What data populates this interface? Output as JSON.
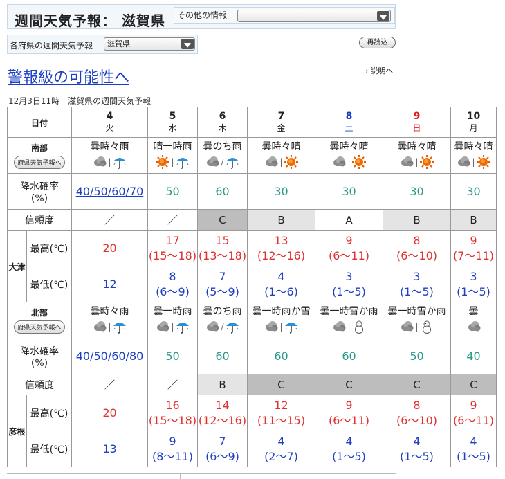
{
  "header": {
    "title": "週間天気予報： 滋賀県",
    "other_info_label": "その他の情報",
    "other_info_value": ""
  },
  "subbar": {
    "label": "各府県の週間天気予報",
    "pref_select_value": "滋賀県",
    "reload_label": "再読込"
  },
  "warning_link": "警報級の可能性へ",
  "explanation_link": "説明へ",
  "timestamp": "12月3日11時　滋賀県の週間天気予報",
  "table": {
    "date_header": "日付",
    "days": [
      {
        "num": "4",
        "wk": "火",
        "type": "weekday"
      },
      {
        "num": "5",
        "wk": "水",
        "type": "weekday"
      },
      {
        "num": "6",
        "wk": "木",
        "type": "weekday"
      },
      {
        "num": "7",
        "wk": "金",
        "type": "weekday"
      },
      {
        "num": "8",
        "wk": "土",
        "type": "sat"
      },
      {
        "num": "9",
        "wk": "日",
        "type": "sun"
      },
      {
        "num": "10",
        "wk": "月",
        "type": "weekday"
      }
    ],
    "rain_prob_label_1": "降水確率",
    "rain_prob_label_2": "(%)",
    "reliability_label": "信頼度",
    "high_label": "最高(℃)",
    "low_label": "最低(℃)",
    "regions": [
      {
        "name": "南部",
        "pref_button": "府県天気予報へ",
        "city": "大津",
        "weather": [
          {
            "text": "曇時々雨",
            "icons": [
              "cloud",
              "umbrella"
            ],
            "sep": "|"
          },
          {
            "text": "晴一時雨",
            "icons": [
              "sun",
              "umbrella"
            ],
            "sep": "|"
          },
          {
            "text": "曇のち雨",
            "icons": [
              "cloud",
              "umbrella"
            ],
            "sep": "/"
          },
          {
            "text": "曇時々晴",
            "icons": [
              "cloud",
              "sun"
            ],
            "sep": "|"
          },
          {
            "text": "曇時々晴",
            "icons": [
              "cloud",
              "sun"
            ],
            "sep": "|"
          },
          {
            "text": "曇時々晴",
            "icons": [
              "cloud",
              "sun"
            ],
            "sep": "|"
          },
          {
            "text": "曇時々晴",
            "icons": [
              "cloud",
              "sun"
            ],
            "sep": "|"
          }
        ],
        "rain": [
          "40/50/60/70",
          "50",
          "60",
          "30",
          "30",
          "30",
          "30"
        ],
        "reliability": [
          "／",
          "／",
          "C",
          "B",
          "A",
          "B",
          "B"
        ],
        "high": [
          {
            "v": "20",
            "r": ""
          },
          {
            "v": "17",
            "r": "(15〜18)"
          },
          {
            "v": "15",
            "r": "(13〜18)"
          },
          {
            "v": "13",
            "r": "(12〜16)"
          },
          {
            "v": "9",
            "r": "(6〜11)"
          },
          {
            "v": "8",
            "r": "(6〜10)"
          },
          {
            "v": "9",
            "r": "(7〜11)"
          }
        ],
        "low": [
          {
            "v": "12",
            "r": ""
          },
          {
            "v": "8",
            "r": "(6〜9)"
          },
          {
            "v": "7",
            "r": "(5〜9)"
          },
          {
            "v": "4",
            "r": "(1〜6)"
          },
          {
            "v": "3",
            "r": "(1〜5)"
          },
          {
            "v": "3",
            "r": "(1〜5)"
          },
          {
            "v": "3",
            "r": "(1〜5)"
          }
        ]
      },
      {
        "name": "北部",
        "pref_button": "府県天気予報へ",
        "city": "彦根",
        "weather": [
          {
            "text": "曇時々雨",
            "icons": [
              "cloud",
              "umbrella"
            ],
            "sep": "|"
          },
          {
            "text": "曇一時雨",
            "icons": [
              "cloud",
              "umbrella"
            ],
            "sep": "|"
          },
          {
            "text": "曇のち雨",
            "icons": [
              "cloud",
              "umbrella"
            ],
            "sep": "/"
          },
          {
            "text": "曇一時雨か雪",
            "icons": [
              "cloud",
              "umbrella"
            ],
            "sep": "|"
          },
          {
            "text": "曇一時雪か雨",
            "icons": [
              "cloud",
              "snowman"
            ],
            "sep": "|"
          },
          {
            "text": "曇一時雪か雨",
            "icons": [
              "cloud",
              "snowman"
            ],
            "sep": "|"
          },
          {
            "text": "曇",
            "icons": [
              "cloud"
            ],
            "sep": ""
          }
        ],
        "rain": [
          "40/50/60/80",
          "50",
          "60",
          "60",
          "60",
          "50",
          "40"
        ],
        "reliability": [
          "／",
          "／",
          "B",
          "C",
          "C",
          "C",
          "C"
        ],
        "high": [
          {
            "v": "20",
            "r": ""
          },
          {
            "v": "16",
            "r": "(15〜18)"
          },
          {
            "v": "14",
            "r": "(12〜16)"
          },
          {
            "v": "12",
            "r": "(11〜15)"
          },
          {
            "v": "9",
            "r": "(6〜11)"
          },
          {
            "v": "8",
            "r": "(6〜10)"
          },
          {
            "v": "9",
            "r": "(6〜11)"
          }
        ],
        "low": [
          {
            "v": "13",
            "r": ""
          },
          {
            "v": "9",
            "r": "(8〜11)"
          },
          {
            "v": "7",
            "r": "(6〜9)"
          },
          {
            "v": "4",
            "r": "(2〜7)"
          },
          {
            "v": "4",
            "r": "(1〜5)"
          },
          {
            "v": "4",
            "r": "(1〜5)"
          },
          {
            "v": "4",
            "r": "(1〜5)"
          }
        ]
      }
    ]
  }
}
